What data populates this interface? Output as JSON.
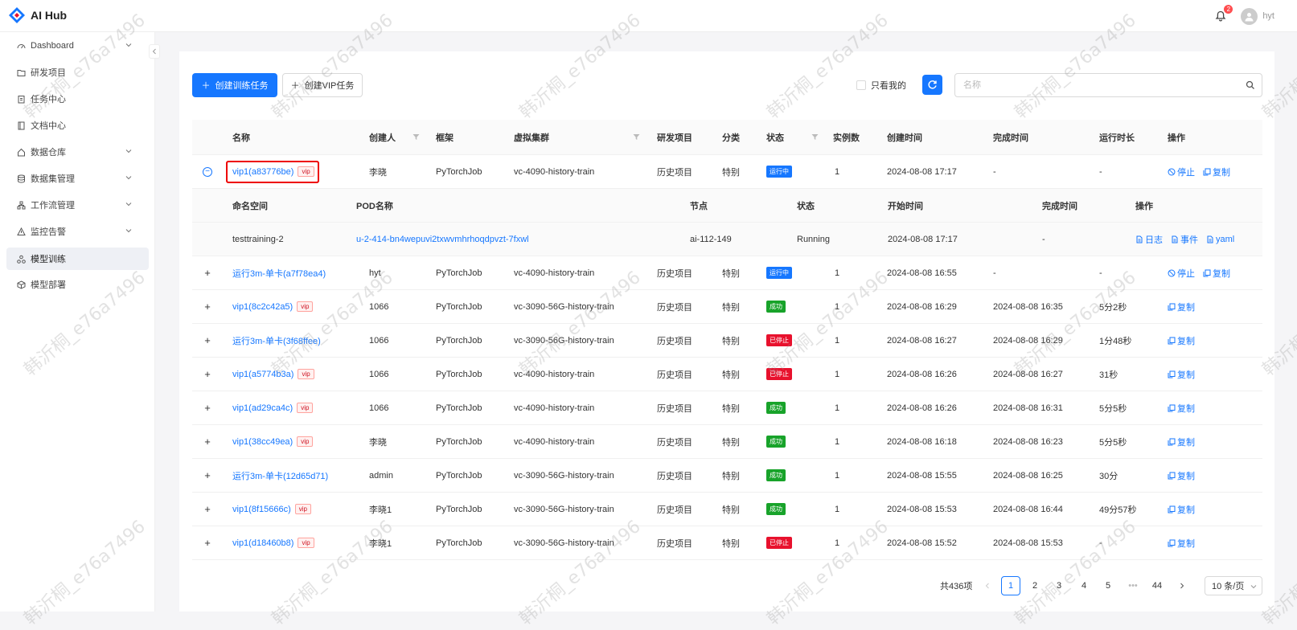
{
  "app": {
    "title": "AI Hub"
  },
  "header": {
    "notifications": "2",
    "username": "hyt"
  },
  "sidebar": {
    "items": [
      {
        "label": "Dashboard"
      },
      {
        "label": "研发项目"
      },
      {
        "label": "任务中心"
      },
      {
        "label": "文档中心"
      },
      {
        "label": "数据仓库"
      },
      {
        "label": "数据集管理"
      },
      {
        "label": "工作流管理"
      },
      {
        "label": "监控告警"
      },
      {
        "label": "模型训练"
      },
      {
        "label": "模型部署"
      }
    ]
  },
  "toolbar": {
    "create_task": "创建训练任务",
    "create_vip": "创建VIP任务",
    "only_mine": "只看我的",
    "search_placeholder": "名称"
  },
  "table": {
    "headers": [
      "名称",
      "创建人",
      "框架",
      "虚拟集群",
      "研发项目",
      "分类",
      "状态",
      "实例数",
      "创建时间",
      "完成时间",
      "运行时长",
      "操作"
    ],
    "vip_label": "vip",
    "action_stop": "停止",
    "action_copy": "复制",
    "rows": [
      {
        "name": "vip1(a83776be)",
        "vip": true,
        "creator": "李晓",
        "framework": "PyTorchJob",
        "cluster": "vc-4090-history-train",
        "project": "历史项目",
        "category": "特别",
        "status": "运行中",
        "status_type": "run",
        "instances": "1",
        "created": "2024-08-08 17:17",
        "finished": "-",
        "duration": "-",
        "stoppable": true,
        "expanded": true
      },
      {
        "name": "运行3m-单卡(a7f78ea4)",
        "vip": false,
        "creator": "hyt",
        "framework": "PyTorchJob",
        "cluster": "vc-4090-history-train",
        "project": "历史项目",
        "category": "特别",
        "status": "运行中",
        "status_type": "run",
        "instances": "1",
        "created": "2024-08-08 16:55",
        "finished": "-",
        "duration": "-",
        "stoppable": true
      },
      {
        "name": "vip1(8c2c42a5)",
        "vip": true,
        "creator": "1066",
        "framework": "PyTorchJob",
        "cluster": "vc-3090-56G-history-train",
        "project": "历史项目",
        "category": "特别",
        "status": "成功",
        "status_type": "ok",
        "instances": "1",
        "created": "2024-08-08 16:29",
        "finished": "2024-08-08 16:35",
        "duration": "5分2秒",
        "stoppable": false
      },
      {
        "name": "运行3m-单卡(3f68ffee)",
        "vip": false,
        "creator": "1066",
        "framework": "PyTorchJob",
        "cluster": "vc-3090-56G-history-train",
        "project": "历史项目",
        "category": "特别",
        "status": "已停止",
        "status_type": "stop",
        "instances": "1",
        "created": "2024-08-08 16:27",
        "finished": "2024-08-08 16:29",
        "duration": "1分48秒",
        "stoppable": false
      },
      {
        "name": "vip1(a5774b3a)",
        "vip": true,
        "creator": "1066",
        "framework": "PyTorchJob",
        "cluster": "vc-4090-history-train",
        "project": "历史项目",
        "category": "特别",
        "status": "已停止",
        "status_type": "stop",
        "instances": "1",
        "created": "2024-08-08 16:26",
        "finished": "2024-08-08 16:27",
        "duration": "31秒",
        "stoppable": false
      },
      {
        "name": "vip1(ad29ca4c)",
        "vip": true,
        "creator": "1066",
        "framework": "PyTorchJob",
        "cluster": "vc-4090-history-train",
        "project": "历史项目",
        "category": "特别",
        "status": "成功",
        "status_type": "ok",
        "instances": "1",
        "created": "2024-08-08 16:26",
        "finished": "2024-08-08 16:31",
        "duration": "5分5秒",
        "stoppable": false
      },
      {
        "name": "vip1(38cc49ea)",
        "vip": true,
        "creator": "李晓",
        "framework": "PyTorchJob",
        "cluster": "vc-4090-history-train",
        "project": "历史项目",
        "category": "特别",
        "status": "成功",
        "status_type": "ok",
        "instances": "1",
        "created": "2024-08-08 16:18",
        "finished": "2024-08-08 16:23",
        "duration": "5分5秒",
        "stoppable": false
      },
      {
        "name": "运行3m-单卡(12d65d71)",
        "vip": false,
        "creator": "admin",
        "framework": "PyTorchJob",
        "cluster": "vc-3090-56G-history-train",
        "project": "历史项目",
        "category": "特别",
        "status": "成功",
        "status_type": "ok",
        "instances": "1",
        "created": "2024-08-08 15:55",
        "finished": "2024-08-08 16:25",
        "duration": "30分",
        "stoppable": false
      },
      {
        "name": "vip1(8f15666c)",
        "vip": true,
        "creator": "李晓1",
        "framework": "PyTorchJob",
        "cluster": "vc-3090-56G-history-train",
        "project": "历史项目",
        "category": "特别",
        "status": "成功",
        "status_type": "ok",
        "instances": "1",
        "created": "2024-08-08 15:53",
        "finished": "2024-08-08 16:44",
        "duration": "49分57秒",
        "stoppable": false
      },
      {
        "name": "vip1(d18460b8)",
        "vip": true,
        "creator": "李晓1",
        "framework": "PyTorchJob",
        "cluster": "vc-3090-56G-history-train",
        "project": "历史项目",
        "category": "特别",
        "status": "已停止",
        "status_type": "stop",
        "instances": "1",
        "created": "2024-08-08 15:52",
        "finished": "2024-08-08 15:53",
        "duration": "-",
        "stoppable": false
      }
    ]
  },
  "subtable": {
    "headers": [
      "命名空间",
      "POD名称",
      "节点",
      "状态",
      "开始时间",
      "完成时间",
      "操作"
    ],
    "row": {
      "namespace": "testtraining-2",
      "pod": "u-2-414-bn4wepuvi2txwvmhrhoqdpvzt-7fxwl",
      "node": "ai-112-149",
      "status": "Running",
      "start": "2024-08-08 17:17",
      "finish": "-"
    },
    "actions": [
      "日志",
      "事件",
      "yaml"
    ]
  },
  "pagination": {
    "total": "共436项",
    "pages": [
      "1",
      "2",
      "3",
      "4",
      "5",
      "•••",
      "44"
    ],
    "current": "1",
    "page_size": "10 条/页"
  },
  "watermark": "韩沂桐_e76a7496",
  "colors": {
    "primary": "#1677ff",
    "success": "#18a32a",
    "danger": "#e8112d"
  }
}
